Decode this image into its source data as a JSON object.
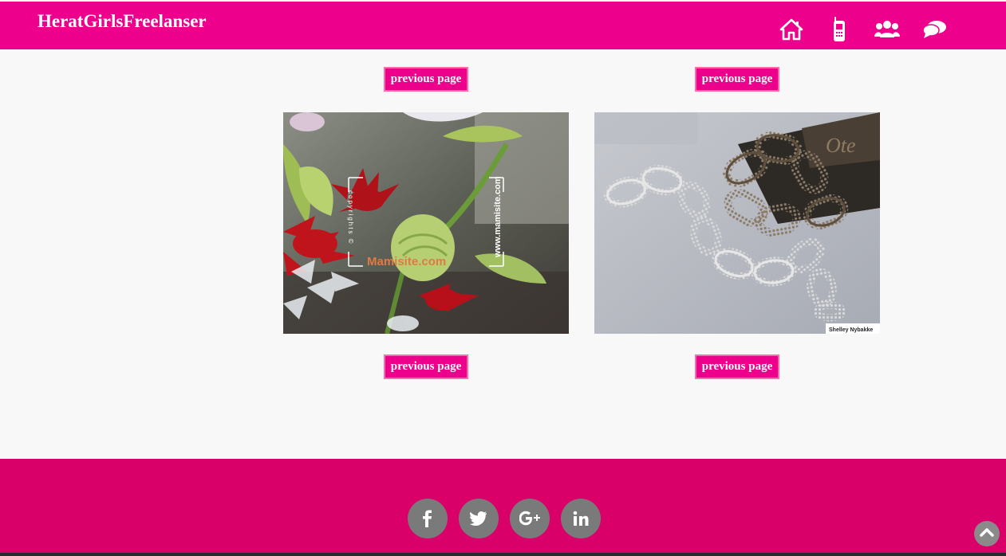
{
  "header": {
    "brand": "HeratGirlsFreelanser",
    "nav_icons": [
      "home-icon",
      "mobile-phone-icon",
      "users-icon",
      "chat-bubbles-icon"
    ]
  },
  "gallery": {
    "button_label": "previous page",
    "items": [
      {
        "top_button": "previous page",
        "bottom_button": "previous page",
        "photo": "beaded-flowers",
        "watermark": "Mamisite.com",
        "watermark_side": "www.mamisite.com",
        "watermark_rotated": "copyrights ©"
      },
      {
        "top_button": "previous page",
        "bottom_button": "previous page",
        "photo": "beaded-bracelet",
        "caption": "Shelley Nybakke"
      }
    ]
  },
  "footer": {
    "social": [
      {
        "name": "facebook-icon",
        "glyph": "f"
      },
      {
        "name": "twitter-icon",
        "glyph": "t"
      },
      {
        "name": "google-plus-icon",
        "glyph": "g+"
      },
      {
        "name": "linkedin-icon",
        "glyph": "in"
      }
    ],
    "scroll_top_icon": "chevron-up-icon"
  },
  "colors": {
    "header_bg": "#ec008c",
    "footer_bg": "#d9006a",
    "button_bg": "#ec008c",
    "page_bg": "#f8f8f8"
  }
}
